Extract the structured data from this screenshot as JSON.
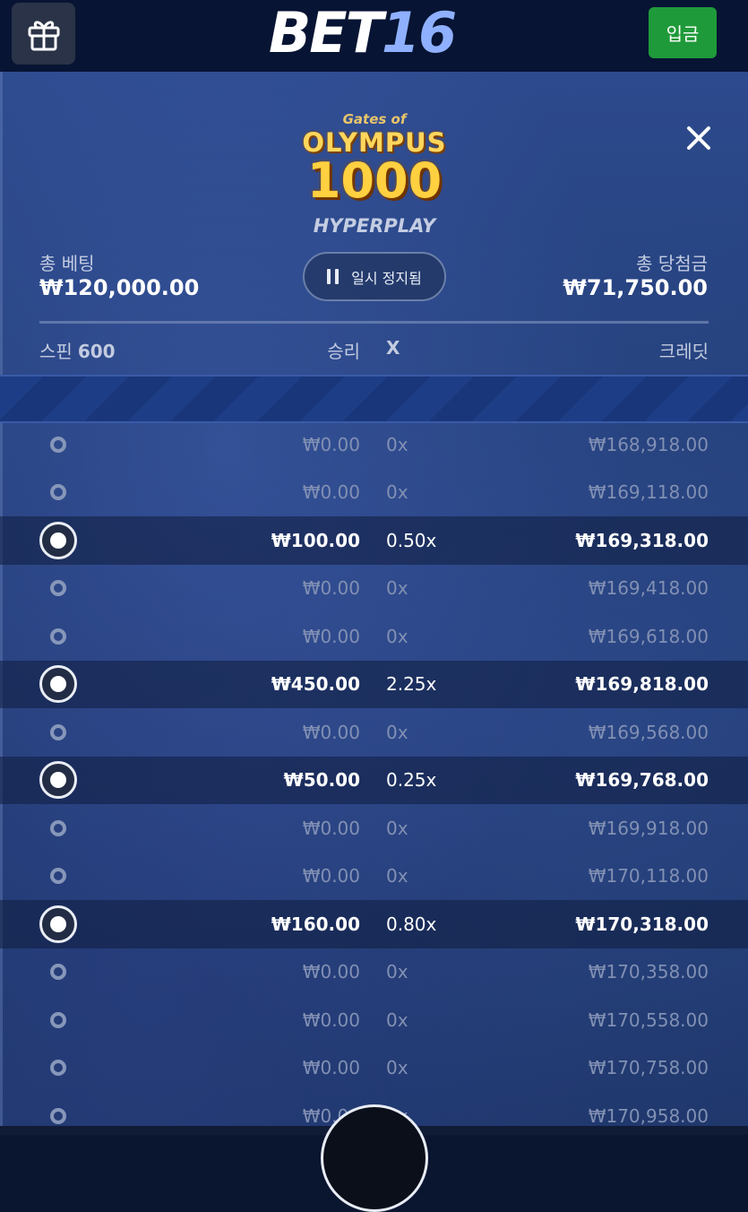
{
  "header": {
    "logo_part1": "BET",
    "logo_part2": "16",
    "deposit_label": "입금",
    "gift_icon": "gift-icon"
  },
  "game": {
    "title_small": "Gates of",
    "title_main": "OLYMPUS",
    "title_number": "1000",
    "subtitle": "HYPERPLAY"
  },
  "summary": {
    "total_bet_label": "총 베팅",
    "total_bet_value": "₩120,000.00",
    "total_win_label": "총 당첨금",
    "total_win_value": "₩71,750.00",
    "pause_label": "일시 정지됨"
  },
  "table": {
    "spin_label": "스핀",
    "spin_count": "600",
    "win_label": "승리",
    "x_label": "X",
    "credit_label": "크레딧",
    "rows": [
      {
        "win": "₩0.00",
        "mult": "0x",
        "credit": "₩168,918.00",
        "highlight": false
      },
      {
        "win": "₩0.00",
        "mult": "0x",
        "credit": "₩169,118.00",
        "highlight": false
      },
      {
        "win": "₩100.00",
        "mult": "0.50x",
        "credit": "₩169,318.00",
        "highlight": true
      },
      {
        "win": "₩0.00",
        "mult": "0x",
        "credit": "₩169,418.00",
        "highlight": false
      },
      {
        "win": "₩0.00",
        "mult": "0x",
        "credit": "₩169,618.00",
        "highlight": false
      },
      {
        "win": "₩450.00",
        "mult": "2.25x",
        "credit": "₩169,818.00",
        "highlight": true
      },
      {
        "win": "₩0.00",
        "mult": "0x",
        "credit": "₩169,568.00",
        "highlight": false
      },
      {
        "win": "₩50.00",
        "mult": "0.25x",
        "credit": "₩169,768.00",
        "highlight": true
      },
      {
        "win": "₩0.00",
        "mult": "0x",
        "credit": "₩169,918.00",
        "highlight": false
      },
      {
        "win": "₩0.00",
        "mult": "0x",
        "credit": "₩170,118.00",
        "highlight": false
      },
      {
        "win": "₩160.00",
        "mult": "0.80x",
        "credit": "₩170,318.00",
        "highlight": true
      },
      {
        "win": "₩0.00",
        "mult": "0x",
        "credit": "₩170,358.00",
        "highlight": false
      },
      {
        "win": "₩0.00",
        "mult": "0x",
        "credit": "₩170,558.00",
        "highlight": false
      },
      {
        "win": "₩0.00",
        "mult": "0x",
        "credit": "₩170,758.00",
        "highlight": false
      },
      {
        "win": "₩0.00",
        "mult": "0x",
        "credit": "₩170,958.00",
        "highlight": false
      }
    ]
  }
}
